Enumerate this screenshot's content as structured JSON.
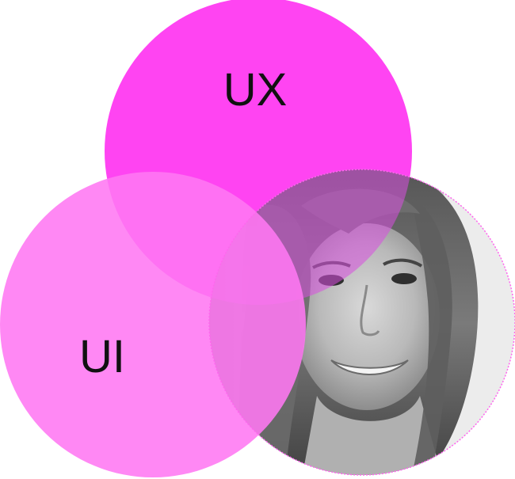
{
  "diagram": {
    "type": "venn",
    "labels": {
      "ux": "UX",
      "ui": "UI"
    },
    "colors": {
      "ux_fill": "#ff44f2",
      "ui_fill": "#ff78f2",
      "photo_border": "#ff66ee",
      "photo_tint": "#d84fe0"
    },
    "photo": {
      "subject": "portrait-photo",
      "style": "grayscale"
    }
  }
}
